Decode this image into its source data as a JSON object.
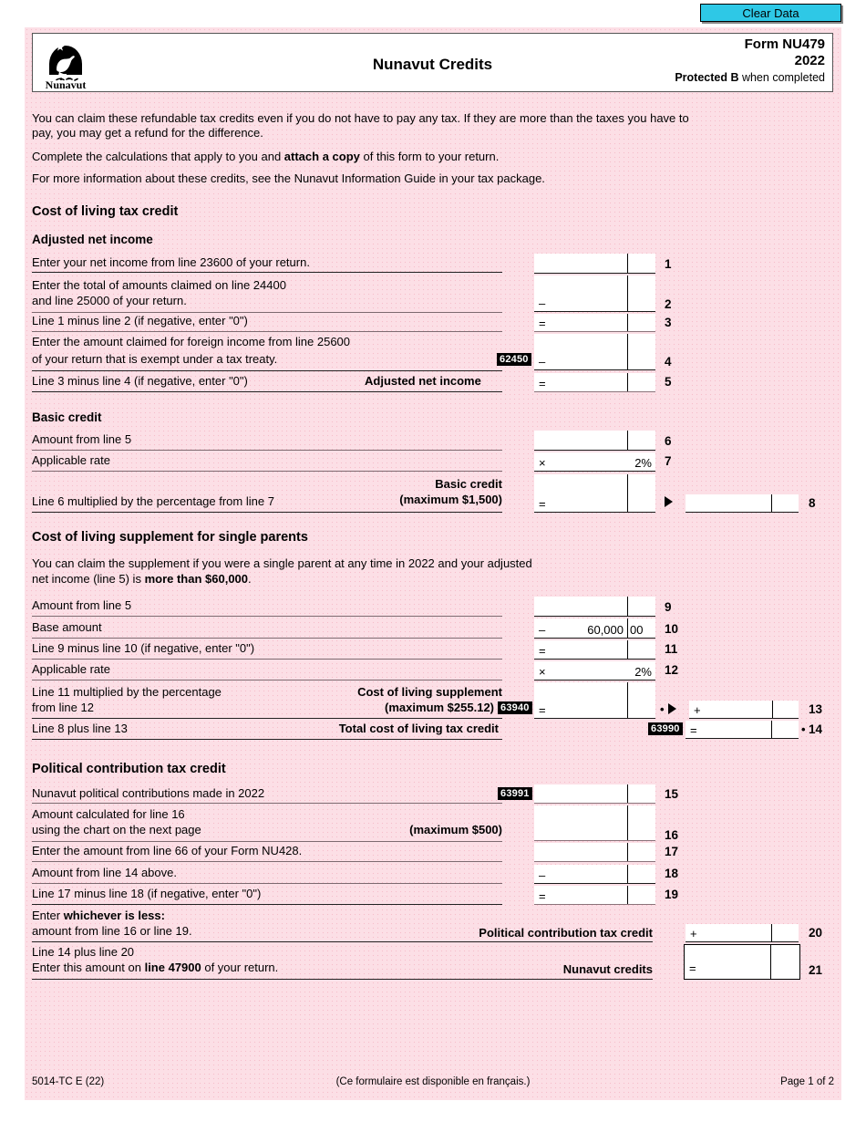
{
  "toolbar": {
    "clear_data_label": "Clear Data"
  },
  "header": {
    "logo_alt": "Nunavut",
    "title": "Nunavut Credits",
    "form_number": "Form NU479",
    "year": "2022",
    "protected_bold": "Protected B",
    "protected_rest": " when completed"
  },
  "intro": {
    "para1": "You can claim these refundable tax credits even if you do not have to pay any tax. If they are more than the taxes you have to",
    "para1b": "pay, you may get a refund for the difference.",
    "para2a": "Complete the calculations that apply to you and ",
    "para2b": "attach a copy",
    "para2c": " of this form to your return.",
    "para3": "For more information about these credits, see the Nunavut Information Guide in your tax package."
  },
  "sections": {
    "cost_of_living": "Cost of living tax credit",
    "adjusted_net_income": "Adjusted net income",
    "basic_credit": "Basic credit",
    "supplement": "Cost of living supplement for single parents",
    "political": "Political contribution tax credit"
  },
  "supplement_note": {
    "line1": "You can claim the supplement if you were a single parent at any time in 2022 and your adjusted",
    "line2a": "net income (line 5) is ",
    "line2b": "more than $60,000",
    "line2c": "."
  },
  "lines": {
    "l1": {
      "label": "Enter your net income from line 23600 of your return.",
      "num": "1",
      "op": ""
    },
    "l2": {
      "label_a": "Enter the total of amounts claimed on line 24400",
      "label_b": "and line 25000 of your return.",
      "num": "2",
      "op": "–"
    },
    "l3": {
      "label": "Line 1 minus line 2 (if negative, enter \"0\")",
      "num": "3",
      "op": "="
    },
    "l4": {
      "label_a": "Enter the amount claimed for foreign income from line 25600",
      "label_b": "of your return that is exempt under a tax treaty.",
      "num": "4",
      "op": "–",
      "code": "62450"
    },
    "l5": {
      "label": "Line 3 minus line 4 (if negative, enter \"0\")",
      "caption": "Adjusted net income",
      "num": "5",
      "op": "="
    },
    "l6": {
      "label": "Amount from line 5",
      "num": "6",
      "op": ""
    },
    "l7": {
      "label": "Applicable rate",
      "num": "7",
      "op": "×",
      "value": "2%"
    },
    "l8": {
      "label": "Line 6 multiplied by the percentage from line 7",
      "caption_a": "Basic credit",
      "caption_b": "(maximum $1,500)",
      "num": "8",
      "op": "="
    },
    "l9": {
      "label": "Amount from line 5",
      "num": "9",
      "op": ""
    },
    "l10": {
      "label": "Base amount",
      "num": "10",
      "op": "–",
      "dollars": "60,000",
      "cents": "00"
    },
    "l11": {
      "label": "Line 9 minus line 10 (if negative, enter \"0\")",
      "num": "11",
      "op": "="
    },
    "l12": {
      "label": "Applicable rate",
      "num": "12",
      "op": "×",
      "value": "2%"
    },
    "l13": {
      "label_a": "Line 11 multiplied by the percentage",
      "label_b": "from line 12",
      "caption_a": "Cost of living supplement",
      "caption_b": "(maximum $255.12)",
      "code": "63940",
      "num": "13",
      "op": "=",
      "op2": "+",
      "bullet": "•"
    },
    "l14": {
      "label": "Line 8 plus line 13",
      "caption": "Total cost of living tax credit",
      "code": "63990",
      "num": "14",
      "op": "=",
      "bullet": "•"
    },
    "l15": {
      "label": "Nunavut political contributions made in 2022",
      "code": "63991",
      "num": "15",
      "op": ""
    },
    "l16": {
      "label_a": "Amount calculated for line 16",
      "label_b": "using the chart on the next page",
      "caption": "(maximum $500)",
      "num": "16",
      "op": ""
    },
    "l17": {
      "label": "Enter the amount from line 66 of your Form NU428.",
      "num": "17",
      "op": ""
    },
    "l18": {
      "label": "Amount from line 14 above.",
      "num": "18",
      "op": "–"
    },
    "l19": {
      "label": "Line 17 minus line 18 (if negative, enter \"0\")",
      "num": "19",
      "op": "="
    },
    "l20": {
      "label_a1": "Enter ",
      "label_a2": "whichever is less:",
      "label_b": "amount from line 16 or line 19.",
      "caption": "Political contribution tax credit",
      "num": "20",
      "op": "+"
    },
    "l21": {
      "label_a": "Line 14 plus line 20",
      "label_b1": "Enter this amount on ",
      "label_b2": "line 47900",
      "label_b3": " of your return.",
      "caption": "Nunavut credits",
      "num": "21",
      "op": "="
    }
  },
  "footer": {
    "left": "5014-TC E (22)",
    "center": "(Ce formulaire est disponible en français.)",
    "right": "Page 1 of 2"
  }
}
